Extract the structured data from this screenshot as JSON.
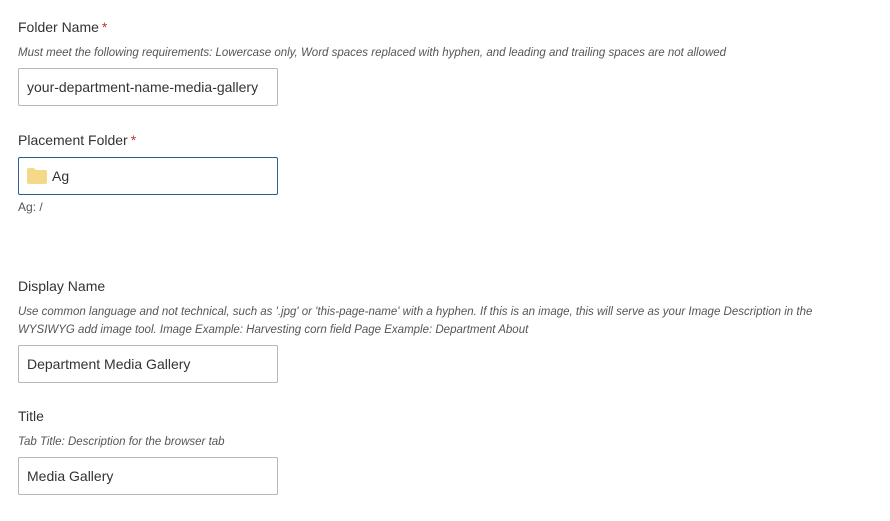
{
  "folder_name": {
    "label": "Folder Name",
    "required_mark": "*",
    "help": "Must meet the following requirements: Lowercase only, Word spaces replaced with hyphen, and leading and trailing spaces are not allowed",
    "value": "your-department-name-media-gallery"
  },
  "placement_folder": {
    "label": "Placement Folder",
    "required_mark": "*",
    "value": "Ag",
    "path": "Ag: /",
    "icon": "folder-icon",
    "icon_color": "#f5d98b"
  },
  "display_name": {
    "label": "Display Name",
    "help_line1": "Use common language and not technical, such as '.jpg' or 'this-page-name' with a hyphen. If this is an image, this will serve as your Image Description in the",
    "help_line2": "WYSIWYG add image tool. Image Example: Harvesting corn field Page Example: Department About",
    "value": "Department Media Gallery"
  },
  "title": {
    "label": "Title",
    "help": "Tab Title: Description for the browser tab",
    "value": "Media Gallery"
  },
  "colors": {
    "required": "#c0392b",
    "focus_border": "#2c5f8d",
    "border": "#b7b7b7"
  }
}
